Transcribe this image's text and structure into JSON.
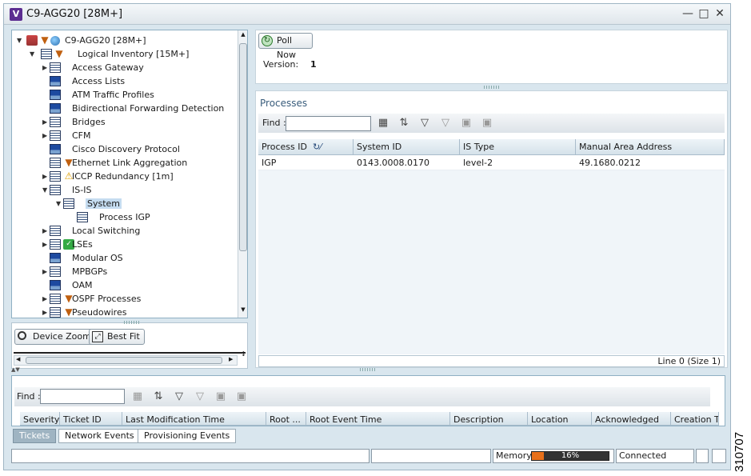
{
  "window": {
    "title": "C9-AGG20 [28M+]",
    "app_icon": "V"
  },
  "tree": {
    "root": "C9-AGG20 [28M+]",
    "logical": "Logical Inventory [15M+]",
    "items": [
      {
        "label": "Access Gateway",
        "icon": "table",
        "expand": true,
        "level": 2
      },
      {
        "label": "Access Lists",
        "icon": "bar",
        "expand": false,
        "level": 2
      },
      {
        "label": "ATM Traffic Profiles",
        "icon": "bar",
        "expand": false,
        "level": 2
      },
      {
        "label": "Bidirectional Forwarding Detection",
        "icon": "bar",
        "expand": false,
        "level": 2
      },
      {
        "label": "Bridges",
        "icon": "table",
        "expand": true,
        "level": 2
      },
      {
        "label": "CFM",
        "icon": "table",
        "expand": true,
        "level": 2
      },
      {
        "label": "Cisco Discovery Protocol",
        "icon": "bar",
        "expand": false,
        "level": 2
      },
      {
        "label": "Ethernet Link Aggregation",
        "icon": "table",
        "expand": false,
        "level": 2,
        "badge": "shield"
      },
      {
        "label": "ICCP Redundancy [1m]",
        "icon": "table",
        "expand": true,
        "level": 2,
        "badge": "warn"
      },
      {
        "label": "IS-IS",
        "icon": "table",
        "expand": "open",
        "level": 2
      },
      {
        "label": "System",
        "icon": "table",
        "expand": "open",
        "level": 3,
        "selected": true
      },
      {
        "label": "Process IGP",
        "icon": "table",
        "expand": false,
        "level": 4
      },
      {
        "label": "Local Switching",
        "icon": "table",
        "expand": true,
        "level": 2
      },
      {
        "label": "LSEs",
        "icon": "table",
        "expand": true,
        "level": 2,
        "badge": "ok"
      },
      {
        "label": "Modular OS",
        "icon": "bar",
        "expand": false,
        "level": 2
      },
      {
        "label": "MPBGPs",
        "icon": "table",
        "expand": true,
        "level": 2
      },
      {
        "label": "OAM",
        "icon": "bar",
        "expand": false,
        "level": 2
      },
      {
        "label": "OSPF Processes",
        "icon": "table",
        "expand": true,
        "level": 2,
        "badge": "shield"
      },
      {
        "label": "Pseudowires",
        "icon": "table",
        "expand": true,
        "level": 2,
        "badge": "shield"
      }
    ]
  },
  "zoom": {
    "device_zoom": "Device Zoom",
    "best_fit": "Best Fit"
  },
  "details": {
    "poll_now": "Poll Now",
    "version_label": "Version:",
    "version_value": "1",
    "processes_title": "Processes",
    "find_label": "Find :",
    "columns": [
      "Process ID",
      "System ID",
      "IS Type",
      "Manual Area Address"
    ],
    "rows": [
      [
        "IGP",
        "0143.0008.0170",
        "level-2",
        "49.1680.0212"
      ]
    ],
    "status": "Line 0 (Size 1)"
  },
  "tickets": {
    "find_label": "Find :",
    "columns": [
      "Severity",
      "Ticket ID",
      "Last Modification Time",
      "Root ...",
      "Root Event Time",
      "Description",
      "Location",
      "Acknowledged",
      "Creation Tir"
    ],
    "tabs": [
      "Tickets",
      "Network Events",
      "Provisioning Events"
    ]
  },
  "statusbar": {
    "memory_label": "Memory:",
    "memory_value": "16%",
    "memory_fraction": 0.16,
    "connection": "Connected"
  },
  "figure_id": "310707",
  "colors": {
    "selection": "#c5dcf0",
    "memory_fill": "#e8701a",
    "window_bg": "#d9e6ee"
  }
}
